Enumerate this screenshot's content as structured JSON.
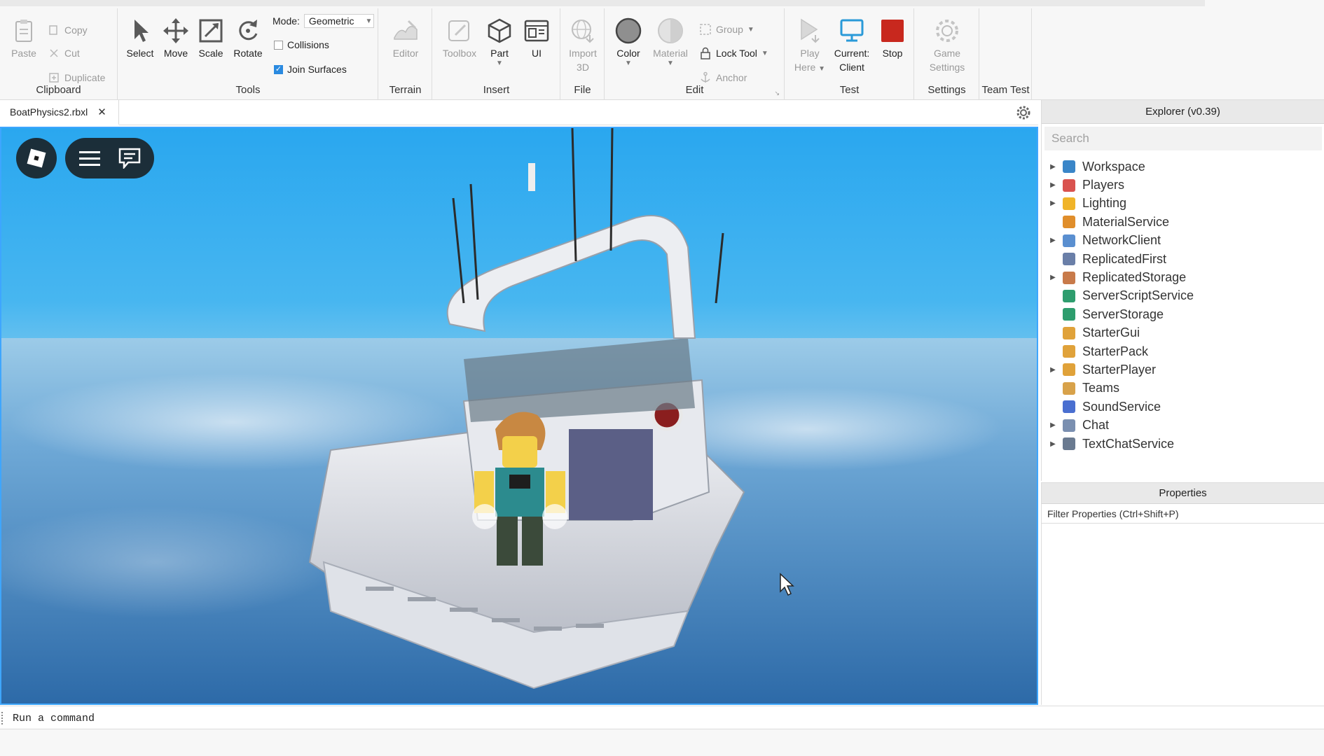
{
  "ribbon": {
    "clipboard": {
      "label": "Clipboard",
      "paste": "Paste",
      "copy": "Copy",
      "cut": "Cut",
      "duplicate": "Duplicate"
    },
    "tools": {
      "label": "Tools",
      "select": "Select",
      "move": "Move",
      "scale": "Scale",
      "rotate": "Rotate",
      "mode_label": "Mode:",
      "mode_value": "Geometric",
      "collisions": "Collisions",
      "collisions_checked": false,
      "join_surfaces": "Join Surfaces",
      "join_surfaces_checked": true
    },
    "terrain": {
      "label": "Terrain",
      "editor": "Editor"
    },
    "insert": {
      "label": "Insert",
      "toolbox": "Toolbox",
      "part": "Part",
      "ui": "UI"
    },
    "file": {
      "label": "File",
      "import_3d_line1": "Import",
      "import_3d_line2": "3D"
    },
    "edit": {
      "label": "Edit",
      "color": "Color",
      "material": "Material",
      "group": "Group",
      "lock_tool": "Lock Tool",
      "anchor": "Anchor"
    },
    "test": {
      "label": "Test",
      "play_here_line1": "Play",
      "play_here_line2": "Here",
      "current_client_line1": "Current:",
      "current_client_line2": "Client",
      "stop": "Stop"
    },
    "settings": {
      "label": "Settings",
      "game_settings_line1": "Game",
      "game_settings_line2": "Settings"
    },
    "team_test": {
      "label": "Team Test"
    }
  },
  "document_tab": {
    "name": "BoatPhysics2.rbxl"
  },
  "explorer": {
    "title": "Explorer (v0.39)",
    "search_placeholder": "Search",
    "items": [
      {
        "label": "Workspace",
        "expandable": true,
        "icon": "workspace-icon",
        "color": "#3a86c8"
      },
      {
        "label": "Players",
        "expandable": true,
        "icon": "players-icon",
        "color": "#d9534f"
      },
      {
        "label": "Lighting",
        "expandable": true,
        "icon": "lighting-icon",
        "color": "#f0b429"
      },
      {
        "label": "MaterialService",
        "expandable": false,
        "icon": "material-service-icon",
        "color": "#e08e2b"
      },
      {
        "label": "NetworkClient",
        "expandable": true,
        "icon": "network-client-icon",
        "color": "#5a8fd0"
      },
      {
        "label": "ReplicatedFirst",
        "expandable": false,
        "icon": "replicated-first-icon",
        "color": "#6a7fa8"
      },
      {
        "label": "ReplicatedStorage",
        "expandable": true,
        "icon": "replicated-storage-icon",
        "color": "#c87a4a"
      },
      {
        "label": "ServerScriptService",
        "expandable": false,
        "icon": "server-script-service-icon",
        "color": "#2e9d6e"
      },
      {
        "label": "ServerStorage",
        "expandable": false,
        "icon": "server-storage-icon",
        "color": "#2e9d6e"
      },
      {
        "label": "StarterGui",
        "expandable": false,
        "icon": "starter-gui-icon",
        "color": "#e0a23a"
      },
      {
        "label": "StarterPack",
        "expandable": false,
        "icon": "starter-pack-icon",
        "color": "#e0a23a"
      },
      {
        "label": "StarterPlayer",
        "expandable": true,
        "icon": "starter-player-icon",
        "color": "#e0a23a"
      },
      {
        "label": "Teams",
        "expandable": false,
        "icon": "teams-icon",
        "color": "#d8a24a"
      },
      {
        "label": "SoundService",
        "expandable": false,
        "icon": "sound-service-icon",
        "color": "#4a6fd0"
      },
      {
        "label": "Chat",
        "expandable": true,
        "icon": "chat-icon",
        "color": "#7a8fb0"
      },
      {
        "label": "TextChatService",
        "expandable": true,
        "icon": "text-chat-service-icon",
        "color": "#6a7a90"
      }
    ]
  },
  "properties": {
    "title": "Properties",
    "filter_placeholder": "Filter Properties (Ctrl+Shift+P)"
  },
  "command_bar": {
    "placeholder": "Run a command"
  },
  "colors": {
    "accent": "#3ea6ff",
    "stop": "#c8281e",
    "client": "#2a9ad8"
  }
}
